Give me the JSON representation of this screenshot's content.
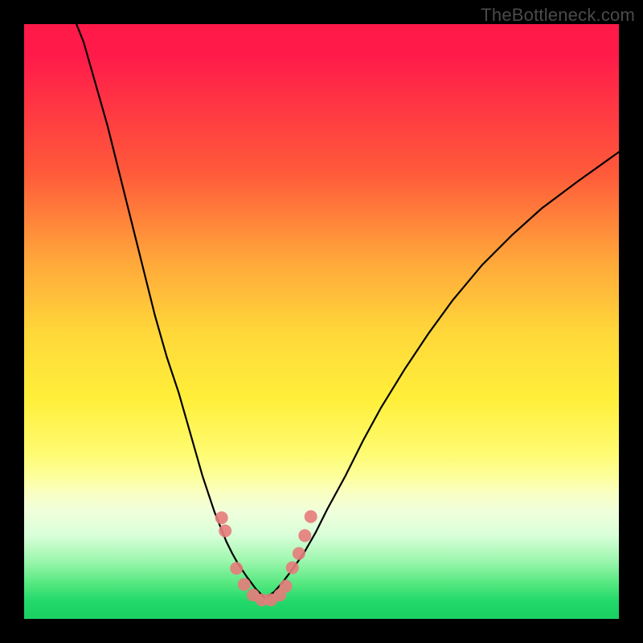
{
  "watermark": "TheBottleneck.com",
  "colors": {
    "frame": "#000000",
    "watermark_text": "#4a4a4a",
    "curve": "#000000",
    "marker": "#e77b7b",
    "gradient_top": "#ff1a4a",
    "gradient_bottom": "#1bcf63"
  },
  "chart_data": {
    "type": "line",
    "title": "",
    "xlabel": "",
    "ylabel": "",
    "xlim": [
      0,
      100
    ],
    "ylim": [
      0,
      100
    ],
    "series": [
      {
        "name": "left-curve",
        "x": [
          8,
          10,
          12,
          14,
          16,
          18,
          20,
          22,
          24,
          25,
          26,
          27,
          28,
          29,
          30,
          31,
          32,
          33,
          34,
          35,
          36,
          37.5,
          39,
          40.5
        ],
        "values": [
          102,
          97,
          90,
          83,
          75,
          67,
          59,
          51,
          44,
          41,
          38,
          34.5,
          31,
          27.5,
          24,
          21,
          18,
          15.5,
          13,
          11,
          9.2,
          7,
          5,
          3.5
        ]
      },
      {
        "name": "right-curve",
        "x": [
          40.5,
          42,
          43.5,
          45,
          47,
          49,
          51,
          54,
          57,
          60,
          64,
          68,
          72,
          77,
          82,
          87,
          93,
          100
        ],
        "values": [
          3.5,
          4.5,
          6.2,
          8.2,
          11,
          14.5,
          18.5,
          24,
          30,
          35.5,
          42,
          48,
          53.5,
          59.5,
          64.5,
          69,
          73.5,
          78.5
        ]
      }
    ],
    "markers": [
      {
        "x": 33.2,
        "y": 17.0
      },
      {
        "x": 33.8,
        "y": 14.8
      },
      {
        "x": 35.7,
        "y": 8.5
      },
      {
        "x": 37.0,
        "y": 5.8
      },
      {
        "x": 38.5,
        "y": 4.0
      },
      {
        "x": 40.0,
        "y": 3.2
      },
      {
        "x": 41.5,
        "y": 3.2
      },
      {
        "x": 43.0,
        "y": 4.0
      },
      {
        "x": 44.0,
        "y": 5.5
      },
      {
        "x": 45.1,
        "y": 8.6
      },
      {
        "x": 46.2,
        "y": 11.0
      },
      {
        "x": 47.2,
        "y": 14.0
      },
      {
        "x": 48.2,
        "y": 17.2
      }
    ],
    "marker_radius_px": 8
  }
}
